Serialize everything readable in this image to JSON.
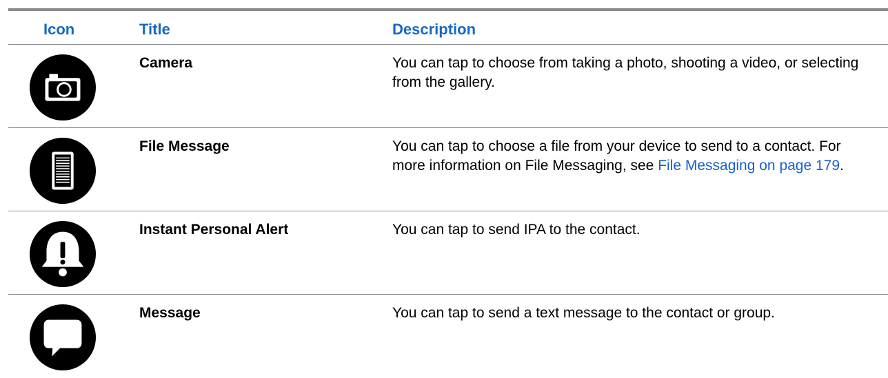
{
  "table": {
    "headers": {
      "icon": "Icon",
      "title": "Title",
      "description": "Description"
    },
    "rows": [
      {
        "icon": "camera-icon",
        "title": "Camera",
        "description": "You can tap to choose from taking a photo, shooting a video, or selecting from the gallery."
      },
      {
        "icon": "file-message-icon",
        "title": "File Message",
        "description_before_link": "You can tap to choose a file from your device to send to a contact. For more information on File Messaging, see ",
        "description_link": "File Messaging on page 179",
        "description_after_link": "."
      },
      {
        "icon": "bell-alert-icon",
        "title": "Instant Personal Alert",
        "description": "You can tap to send IPA to the contact."
      },
      {
        "icon": "message-bubble-icon",
        "title": "Message",
        "description": "You can tap to send a text message to the contact or group."
      }
    ]
  },
  "colors": {
    "header_text": "#1668c7",
    "link": "#1a5fd0",
    "rule": "#8a8a8a"
  }
}
